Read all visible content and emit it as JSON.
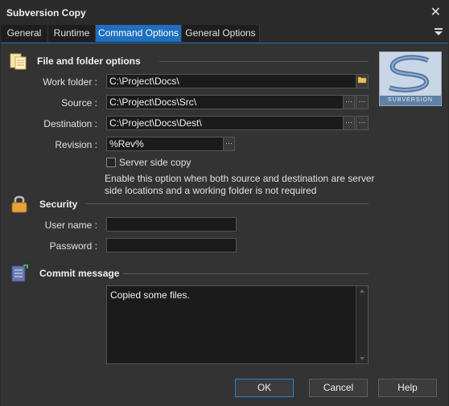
{
  "window": {
    "title": "Subversion Copy"
  },
  "tabs": [
    {
      "label": "General"
    },
    {
      "label": "Runtime"
    },
    {
      "label": "Command Options"
    },
    {
      "label": "General Options"
    }
  ],
  "file_folder": {
    "section_title": "File and folder options",
    "work_folder_label": "Work folder :",
    "work_folder_value": "C:\\Project\\Docs\\",
    "source_label": "Source :",
    "source_value": "C:\\Project\\Docs\\Src\\",
    "destination_label": "Destination :",
    "destination_value": "C:\\Project\\Docs\\Dest\\",
    "revision_label": "Revision :",
    "revision_value": "%Rev%",
    "server_side_copy_label": "Server side copy",
    "server_side_copy_checked": false,
    "note_line1": "Enable this option when both source and destination are server",
    "note_line2": "side locations and a working folder is not required",
    "ellipsis": "···"
  },
  "security": {
    "section_title": "Security",
    "username_label": "User name :",
    "username_value": "",
    "password_label": "Password :",
    "password_value": ""
  },
  "commit": {
    "section_title": "Commit message",
    "message": "Copied some files."
  },
  "logo": {
    "text": "SUBVERSION"
  },
  "buttons": {
    "ok": "OK",
    "cancel": "Cancel",
    "help": "Help"
  },
  "colors": {
    "accent": "#1e6fbf",
    "background": "#333333"
  }
}
